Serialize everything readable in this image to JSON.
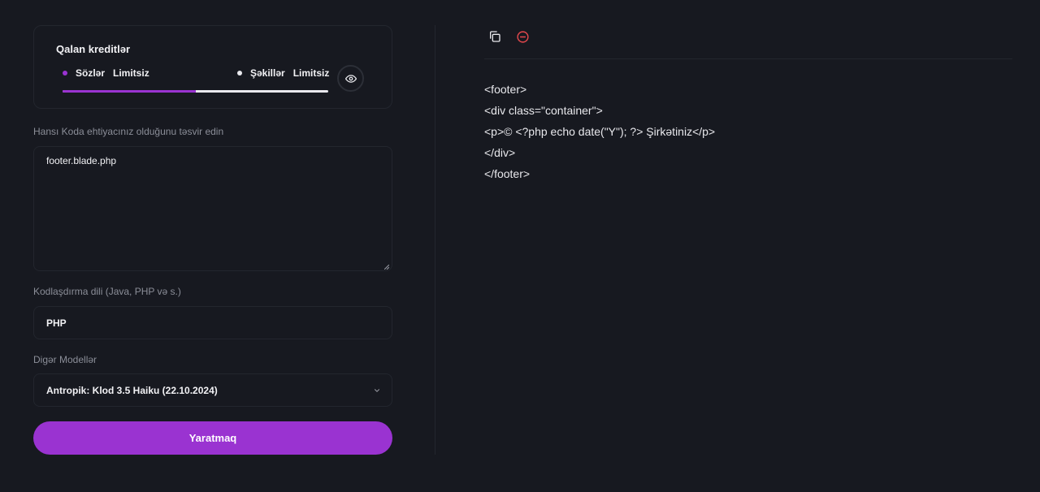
{
  "credits": {
    "title": "Qalan kreditlər",
    "words": {
      "label": "Sözlər",
      "value": "Limitsiz",
      "dot_color": "#9a33d1"
    },
    "images": {
      "label": "Şəkillər",
      "value": "Limitsiz",
      "dot_color": "#e9e9ee"
    },
    "progress_fraction": 0.5,
    "eye_icon": "eye-icon"
  },
  "form": {
    "description_label": "Hansı Koda ehtiyacınız olduğunu təsvir edin",
    "description_value": "footer.blade.php",
    "language_label": "Kodlaşdırma dili (Java, PHP və s.)",
    "language_value": "PHP",
    "model_label": "Digər Modellər",
    "model_value": "Antropik: Klod 3.5 Haiku (22.10.2024)",
    "generate_label": "Yaratmaq"
  },
  "output": {
    "copy_icon": "copy-icon",
    "clear_icon": "minus-circle-icon",
    "lines": [
      "<footer>",
      "<div class=\"container\">",
      "<p>© <?php echo date(\"Y\"); ?> Şirkətiniz</p>",
      "</div>",
      "</footer>"
    ]
  },
  "colors": {
    "accent": "#9a33d1",
    "background": "#171920",
    "border": "#23262e",
    "danger": "#e5484d"
  }
}
